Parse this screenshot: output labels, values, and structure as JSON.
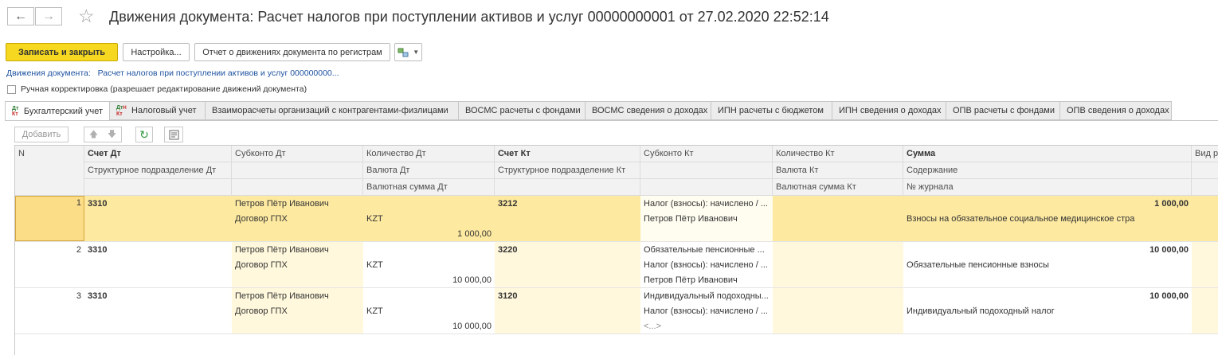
{
  "nav": {
    "back_icon": "arrow-left-icon",
    "forward_icon": "arrow-right-icon",
    "favorite_icon": "star-icon"
  },
  "title": "Движения документа: Расчет налогов при поступлении активов и услуг 00000000001 от 27.02.2020 22:52:14",
  "toolbar": {
    "save_close": "Записать и закрыть",
    "settings": "Настройка...",
    "report": "Отчет о движениях документа по регистрам",
    "extra_icon": "structure-icon"
  },
  "document_link": {
    "label": "Движения документа:",
    "value": "Расчет налогов при поступлении активов и услуг 000000000..."
  },
  "manual_edit": {
    "label": "Ручная корректировка (разрешает редактирование движений документа)",
    "checked": false
  },
  "tabs": [
    "Бухгалтерский учет",
    "Налоговый учет",
    "Взаиморасчеты организаций с контрагентами-физлицами",
    "ВОСМС расчеты с фондами",
    "ВОСМС сведения о доходах",
    "ИПН расчеты с бюджетом",
    "ИПН сведения о доходах",
    "ОПВ расчеты с фондами",
    "ОПВ сведения о доходах"
  ],
  "tab_icon_text": {
    "top": "Дт",
    "bottom": "Кт",
    "top2": "Дт",
    "bottom2": "Кт",
    "mark": "Н"
  },
  "table_toolbar": {
    "add": "Добавить"
  },
  "columns": {
    "n": "N",
    "acc_dt": "Счет Дт",
    "sub_dt": "Субконто Дт",
    "qty_dt": "Количество Дт",
    "acc_kt": "Счет Кт",
    "sub_kt": "Субконто Кт",
    "qty_kt": "Количество Кт",
    "sum": "Сумма",
    "extra": "Вид р",
    "div_dt": "Структурное подразделение Дт",
    "cur_dt": "Валюта Дт",
    "cursum_dt": "Валютная сумма Дт",
    "div_kt": "Структурное подразделение Кт",
    "cur_kt": "Валюта Кт",
    "cursum_kt": "Валютная сумма Кт",
    "content": "Содержание",
    "journal": "№ журнала"
  },
  "rows": [
    {
      "n": "1",
      "acc_dt": "3310",
      "sub_dt": [
        "Петров Пётр Иванович",
        "Договор ГПХ",
        ""
      ],
      "cur_dt": "KZT",
      "cursum_dt": "1 000,00",
      "acc_kt": "3212",
      "sub_kt": [
        "Налог (взносы): начислено / ...",
        "Петров Пётр Иванович",
        ""
      ],
      "sum": "1 000,00",
      "content": "Взносы на обязательное социальное медицинское стра"
    },
    {
      "n": "2",
      "acc_dt": "3310",
      "sub_dt": [
        "Петров Пётр Иванович",
        "Договор ГПХ",
        ""
      ],
      "cur_dt": "KZT",
      "cursum_dt": "10 000,00",
      "acc_kt": "3220",
      "sub_kt": [
        "Обязательные пенсионные ...",
        "Налог (взносы): начислено / ...",
        "Петров Пётр Иванович"
      ],
      "sum": "10 000,00",
      "content": "Обязательные пенсионные взносы"
    },
    {
      "n": "3",
      "acc_dt": "3310",
      "sub_dt": [
        "Петров Пётр Иванович",
        "Договор ГПХ",
        ""
      ],
      "cur_dt": "KZT",
      "cursum_dt": "10 000,00",
      "acc_kt": "3120",
      "sub_kt": [
        "Индивидуальный подоходны...",
        "Налог (взносы): начислено / ...",
        "<...>"
      ],
      "sum": "10 000,00",
      "content": "Индивидуальный подоходный налог"
    }
  ]
}
